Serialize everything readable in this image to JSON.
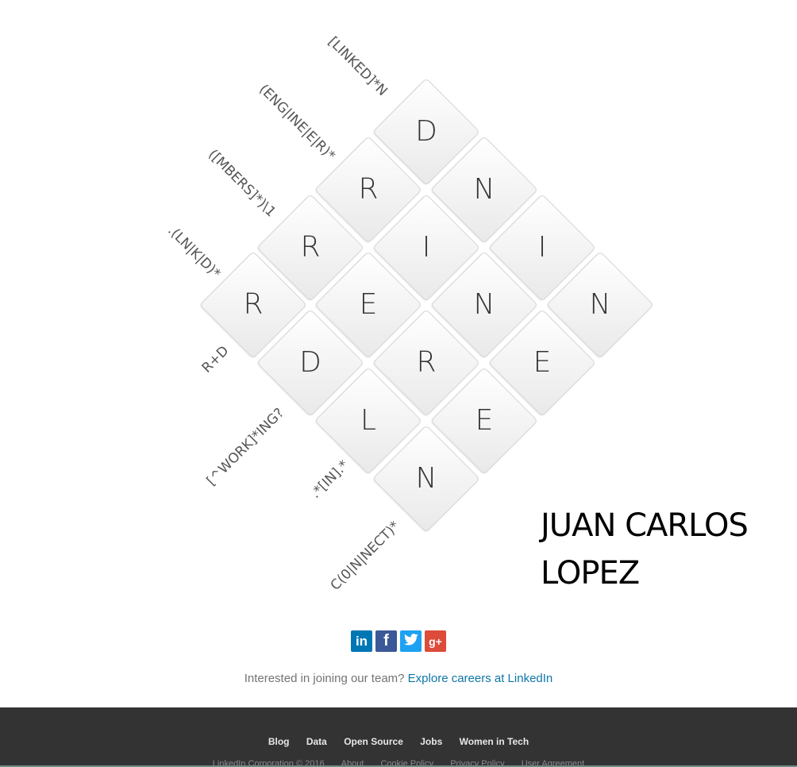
{
  "puzzle": {
    "tiles": [
      "D",
      "R",
      "N",
      "R",
      "I",
      "I",
      "R",
      "E",
      "N",
      "N",
      "D",
      "R",
      "E",
      "L",
      "E",
      "N"
    ],
    "clues_upper": [
      "[LINKED]*N",
      "(ENG|INE|E|R)*",
      "([MBERS]*)\\1",
      ".(LN|K|D)*"
    ],
    "clues_lower": [
      "R+D",
      "[^WORK]*ING?",
      ".*[IN].*",
      "C(0|N|NECT)*"
    ]
  },
  "name": {
    "line1": "JUAN CARLOS",
    "line2": "LOPEZ"
  },
  "social": {
    "linkedin": "in",
    "facebook": "f",
    "twitter": "t",
    "googleplus": "g+"
  },
  "careers": {
    "prompt": "Interested in joining our team?",
    "link": "Explore careers at LinkedIn"
  },
  "footer": {
    "nav": [
      "Blog",
      "Data",
      "Open Source",
      "Jobs",
      "Women in Tech"
    ],
    "legal": [
      "LinkedIn Corporation © 2016",
      "About",
      "Cookie Policy",
      "Privacy Policy",
      "User Agreement"
    ]
  }
}
